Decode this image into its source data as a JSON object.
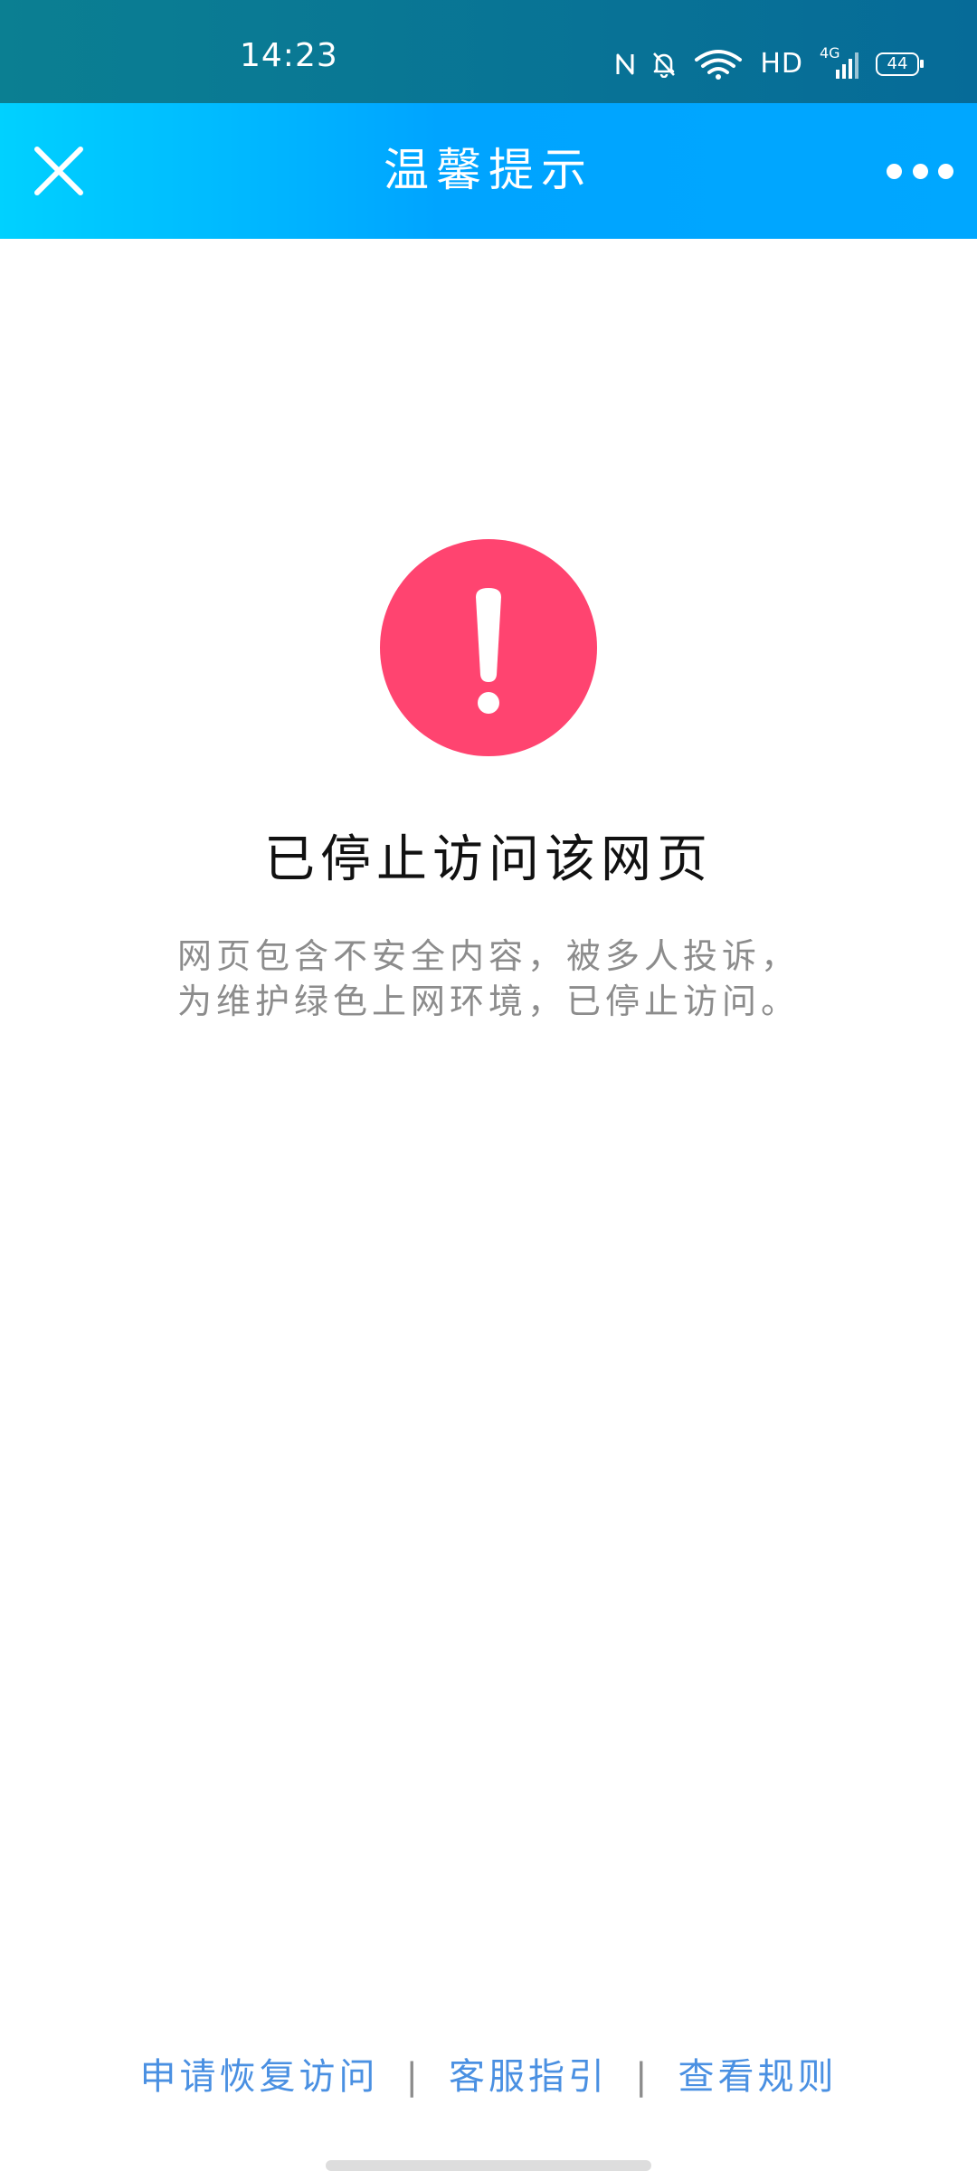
{
  "status_bar": {
    "time": "14:23",
    "hd_label": "HD",
    "network_label": "4G",
    "battery_level": "44",
    "icons": [
      "nfc-icon",
      "bell-muted-icon",
      "wifi-icon",
      "signal-icon",
      "battery-icon"
    ]
  },
  "header": {
    "title": "温馨提示",
    "close_icon": "close-icon",
    "more_icon": "more-icon"
  },
  "main": {
    "icon": "exclamation-icon",
    "icon_color": "#ff4470",
    "title": "已停止访问该网页",
    "desc_line1": "网页包含不安全内容，被多人投诉，",
    "desc_line2": "为维护绿色上网环境，已停止访问。"
  },
  "footer": {
    "link1": "申请恢复访问",
    "link2": "客服指引",
    "link3": "查看规则",
    "separator": "|",
    "link_color": "#4a90e2"
  },
  "colors": {
    "status_bar": "#0b7f92",
    "header_start": "#00d1ff",
    "header_end": "#00a7ff"
  }
}
